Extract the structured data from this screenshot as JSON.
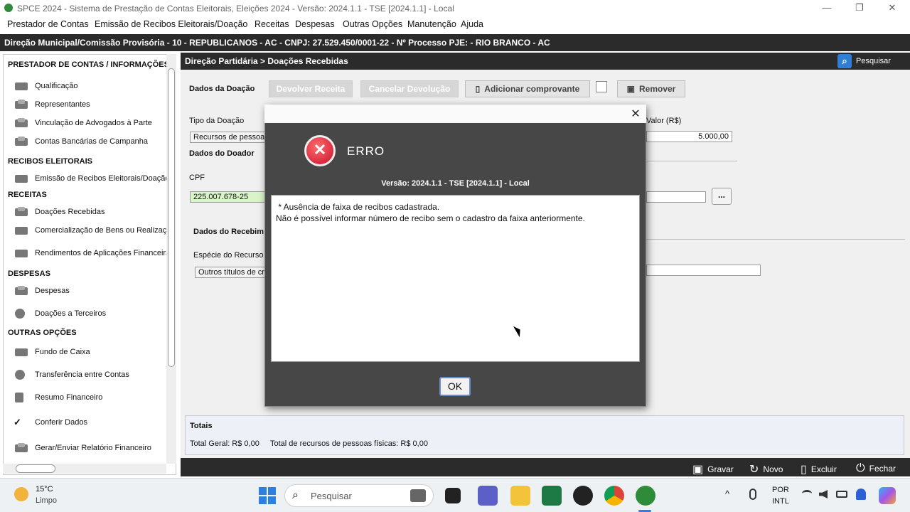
{
  "window": {
    "title": "SPCE 2024 - Sistema de Prestação de Contas Eleitorais, Eleições 2024 - Versão: 2024.1.1 - TSE [2024.1.1] - Local",
    "controls": [
      "—",
      "❐",
      "✕"
    ]
  },
  "menu": [
    "Prestador de Contas",
    "Emissão de Recibos Eleitorais/Doação",
    "Receitas",
    "Despesas",
    "Outras Opções",
    "Manutenção",
    "Ajuda"
  ],
  "infobar": "Direção Municipal/Comissão Provisória - 10 - REPUBLICANOS - AC - CNPJ: 27.529.450/0001-22 - Nº Processo PJE:  - RIO BRANCO - AC",
  "sidebar": {
    "sections": [
      {
        "title": "PRESTADOR DE CONTAS / INFORMAÇÕES",
        "items": [
          "Qualificação",
          "Representantes",
          "Vinculação de Advogados à Parte",
          "Contas Bancárias de Campanha"
        ]
      },
      {
        "title": "RECIBOS ELEITORAIS",
        "items": [
          "Emissão de Recibos Eleitorais/Doação"
        ]
      },
      {
        "title": "RECEITAS",
        "items": [
          "Doações Recebidas",
          "Comercialização de Bens ou Realização",
          "Rendimentos de Aplicações Financeira"
        ]
      },
      {
        "title": "DESPESAS",
        "items": [
          "Despesas",
          "Doações a Terceiros"
        ]
      },
      {
        "title": "OUTRAS OPÇÕES",
        "items": [
          "Fundo de Caixa",
          "Transferência entre Contas",
          "Resumo Financeiro",
          "Conferir Dados",
          "Gerar/Enviar Relatório Financeiro"
        ]
      }
    ]
  },
  "main": {
    "breadcrumb": "Direção Partidária > Doações Recebidas",
    "search_label": "Pesquisar",
    "section_doacao": "Dados da Doação",
    "buttons": {
      "devolver": "Devolver Receita",
      "cancelar": "Cancelar Devolução",
      "adicionar": "Adicionar comprovante",
      "remover": "Remover"
    },
    "tipo_label": "Tipo da Doação",
    "tipo_value": "Recursos de pessoa",
    "valor_label": "Valor (R$)",
    "valor_value": "5.000,00",
    "doador_section": "Dados do Doador",
    "cpf_label": "CPF",
    "cpf_value": "225.007.678-25",
    "lookup_btn": "...",
    "recebimento_section": "Dados do Recebim",
    "especie_label": "Espécie do Recurso",
    "especie_value": "Outros títulos de cr"
  },
  "totals": {
    "title": "Totais",
    "geral": "Total Geral: R$ 0,00",
    "pf": "Total de recursos de pessoas físicas: R$ 0,00"
  },
  "bottombar": {
    "gravar": "Gravar",
    "novo": "Novo",
    "excluir": "Excluir",
    "fechar": "Fechar"
  },
  "dialog": {
    "close": "✕",
    "icon_glyph": "✕",
    "title": "ERRO",
    "version": "Versão: 2024.1.1  -  TSE [2024.1.1] - Local",
    "line1": " * Ausência de faixa de recibos cadastrada.",
    "line2": "Não é possível informar número de recibo sem o cadastro da faixa anteriormente.",
    "ok": "OK"
  },
  "taskbar": {
    "weather_temp": "15°C",
    "weather_desc": "Limpo",
    "search_placeholder": "Pesquisar",
    "lang1": "POR",
    "lang2": "INTL",
    "chevron": "^"
  },
  "colors": {
    "dark_bar": "#2b2b2b",
    "error_red": "#c8102e",
    "dialog_bg": "#474747",
    "cpf_green": "#d8f5c8"
  }
}
